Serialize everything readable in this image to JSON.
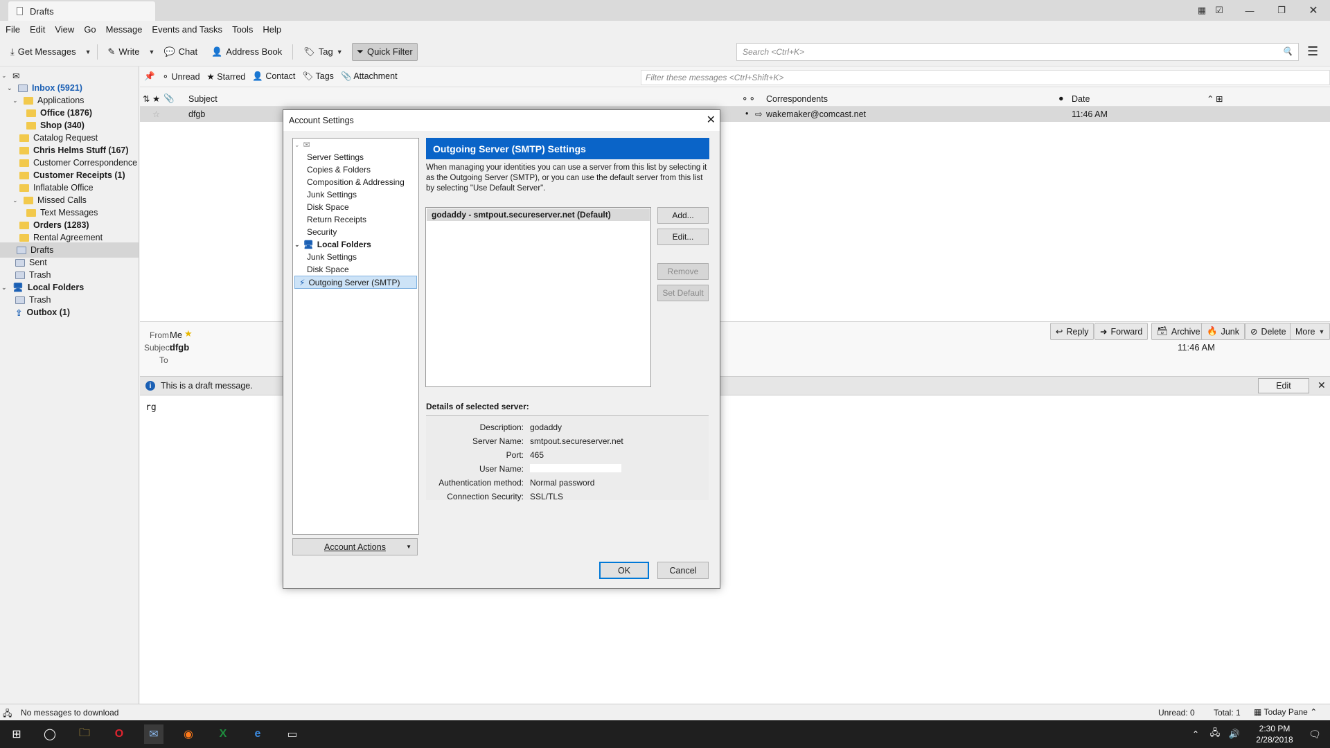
{
  "window": {
    "tab_title": "Drafts"
  },
  "menubar": [
    "File",
    "Edit",
    "View",
    "Go",
    "Message",
    "Events and Tasks",
    "Tools",
    "Help"
  ],
  "toolbar": {
    "get_messages": "Get Messages",
    "write": "Write",
    "chat": "Chat",
    "address_book": "Address Book",
    "tag": "Tag",
    "quick_filter": "Quick Filter",
    "search_placeholder": "Search <Ctrl+K>"
  },
  "folders": [
    {
      "label": "Inbox (5921)",
      "bold": true
    },
    {
      "label": "Applications"
    },
    {
      "label": "Office (1876)",
      "bold": true
    },
    {
      "label": "Shop (340)",
      "bold": true
    },
    {
      "label": "Catalog Request"
    },
    {
      "label": "Chris Helms Stuff (167)",
      "bold": true
    },
    {
      "label": "Customer Correspondence"
    },
    {
      "label": "Customer Receipts (1)",
      "bold": true
    },
    {
      "label": "Inflatable Office"
    },
    {
      "label": "Missed Calls"
    },
    {
      "label": "Text Messages"
    },
    {
      "label": "Orders (1283)",
      "bold": true
    },
    {
      "label": "Rental Agreement"
    },
    {
      "label": "Drafts"
    },
    {
      "label": "Sent"
    },
    {
      "label": "Trash"
    },
    {
      "label": "Local Folders",
      "bold": true
    },
    {
      "label": "Trash"
    },
    {
      "label": "Outbox (1)",
      "bold": true
    }
  ],
  "quickfilter": {
    "unread": "Unread",
    "starred": "Starred",
    "contact": "Contact",
    "tags": "Tags",
    "attachment": "Attachment",
    "filter_placeholder": "Filter these messages <Ctrl+Shift+K>"
  },
  "columns": {
    "subject": "Subject",
    "correspondents": "Correspondents",
    "date": "Date"
  },
  "message": {
    "subject": "dfgb",
    "correspondent": "wakemaker@comcast.net",
    "date": "11:46 AM"
  },
  "header": {
    "from_label": "From",
    "from_value": "Me",
    "subject_label": "Subject",
    "subject_value": "dfgb",
    "to_label": "To",
    "time": "11:46 AM"
  },
  "actions": {
    "reply": "Reply",
    "forward": "Forward",
    "archive": "Archive",
    "junk": "Junk",
    "delete": "Delete",
    "more": "More"
  },
  "draftbar": {
    "text": "This is a draft message.",
    "edit": "Edit"
  },
  "body": "rg",
  "status": {
    "left": "No messages to download",
    "unread": "Unread: 0",
    "total": "Total: 1",
    "today": "Today Pane"
  },
  "clock": {
    "time": "2:30 PM",
    "date": "2/28/2018"
  },
  "dialog": {
    "title": "Account Settings",
    "tree": [
      "Server Settings",
      "Copies & Folders",
      "Composition & Addressing",
      "Junk Settings",
      "Disk Space",
      "Return Receipts",
      "Security",
      "Local Folders",
      "Junk Settings",
      "Disk Space",
      "Outgoing Server (SMTP)"
    ],
    "account_actions": "Account Actions",
    "heading": "Outgoing Server (SMTP) Settings",
    "description": "When managing your identities you can use a server from this list by selecting it as the Outgoing Server (SMTP), or you can use the default server from this list by selecting \"Use Default Server\".",
    "server_item": "godaddy - smtpout.secureserver.net (Default)",
    "buttons": {
      "add": "Add...",
      "edit": "Edit...",
      "remove": "Remove",
      "set_default": "Set Default",
      "ok": "OK",
      "cancel": "Cancel"
    },
    "details_title": "Details of selected server:",
    "details": {
      "description_label": "Description:",
      "description": "godaddy",
      "server_label": "Server Name:",
      "server": "smtpout.secureserver.net",
      "port_label": "Port:",
      "port": "465",
      "user_label": "User Name:",
      "user": "",
      "auth_label": "Authentication method:",
      "auth": "Normal password",
      "security_label": "Connection Security:",
      "security": "SSL/TLS"
    }
  }
}
